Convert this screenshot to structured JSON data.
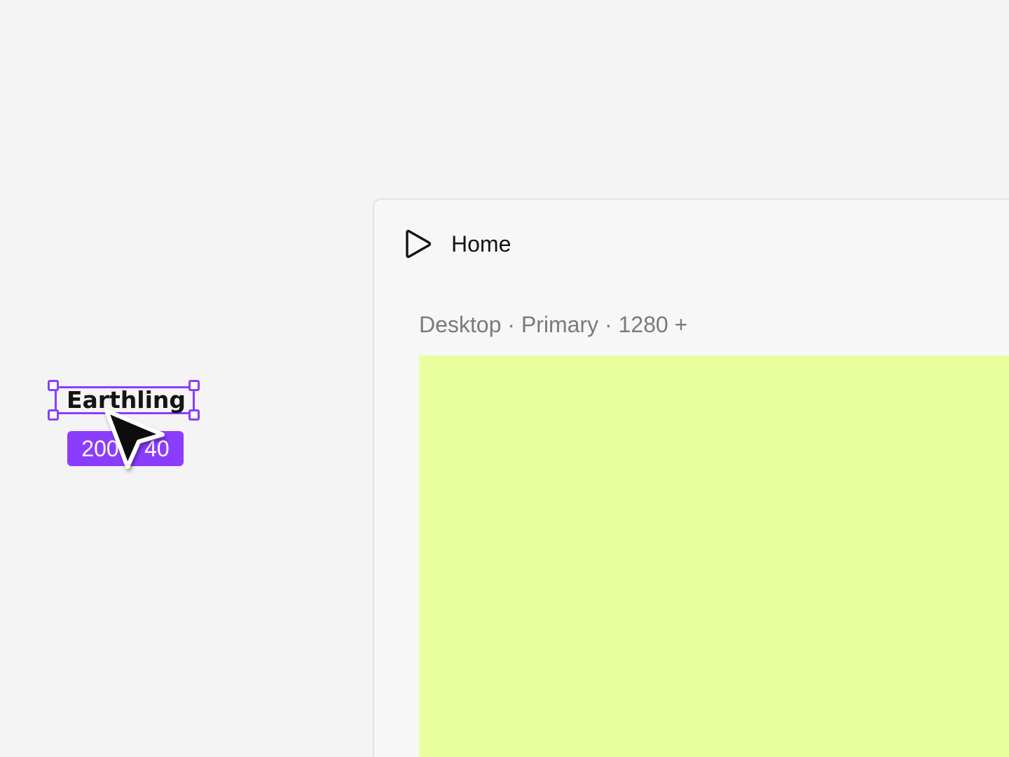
{
  "layer": {
    "text": "Earthling",
    "size": "200 × 40"
  },
  "frame": {
    "title": "Home",
    "breakpoint": "Desktop · Primary · 1280 +",
    "play_icon": "play-icon"
  },
  "colors": {
    "canvas": "#f4f4f5",
    "selection": "#8b3dff",
    "preview_fill": "#e9ff9e",
    "frame_bg": "#f7f7f7"
  }
}
